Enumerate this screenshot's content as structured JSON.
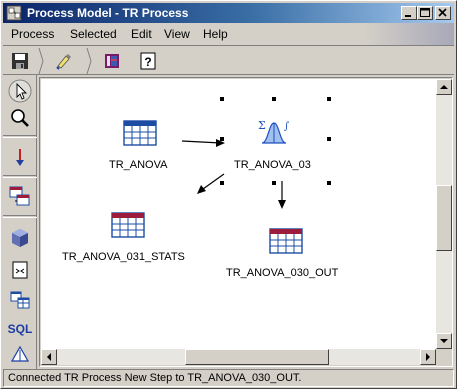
{
  "window": {
    "title": "Process Model - TR Process"
  },
  "menu": {
    "items": [
      {
        "label": "Process"
      },
      {
        "label": "Selected"
      },
      {
        "label": "Edit"
      },
      {
        "label": "View"
      },
      {
        "label": "Help"
      }
    ]
  },
  "toolbar": {
    "items": [
      {
        "icon": "save-icon"
      },
      {
        "icon": "highlighter-icon"
      },
      {
        "icon": "book-icon"
      },
      {
        "icon": "help-icon",
        "label": "?"
      }
    ]
  },
  "palette": {
    "items": [
      {
        "icon": "pointer-icon"
      },
      {
        "icon": "zoom-icon"
      },
      {
        "icon": "link-arrow-icon"
      },
      {
        "icon": "table-link-icon"
      },
      {
        "icon": "cube-icon"
      },
      {
        "icon": "file-icon"
      },
      {
        "icon": "tables-icon"
      },
      {
        "icon": "sql-icon",
        "label": "SQL"
      },
      {
        "icon": "triangle-icon"
      }
    ]
  },
  "diagram": {
    "nodes": [
      {
        "id": "tr-anova",
        "label": "TR_ANOVA",
        "icon": "table-icon"
      },
      {
        "id": "tr-anova-03",
        "label": "TR_ANOVA_03",
        "icon": "statistics-icon",
        "selected": true
      },
      {
        "id": "tr-anova-031-stats",
        "label": "TR_ANOVA_031_STATS",
        "icon": "table-icon"
      },
      {
        "id": "tr-anova-030-out",
        "label": "TR_ANOVA_030_OUT",
        "icon": "table-icon"
      }
    ],
    "links": [
      {
        "from": "tr-anova",
        "to": "tr-anova-03"
      },
      {
        "from": "tr-anova-03",
        "to": "tr-anova-031-stats"
      },
      {
        "from": "tr-anova-03",
        "to": "tr-anova-030-out"
      }
    ]
  },
  "status": {
    "text": "Connected TR Process New Step to TR_ANOVA_030_OUT."
  },
  "colors": {
    "titlebar_start": "#0a246a",
    "titlebar_end": "#a6caf0",
    "table_header": "#9c1c3c",
    "table_grid": "#1c4ca4",
    "stat_icon": "#2050c0"
  }
}
